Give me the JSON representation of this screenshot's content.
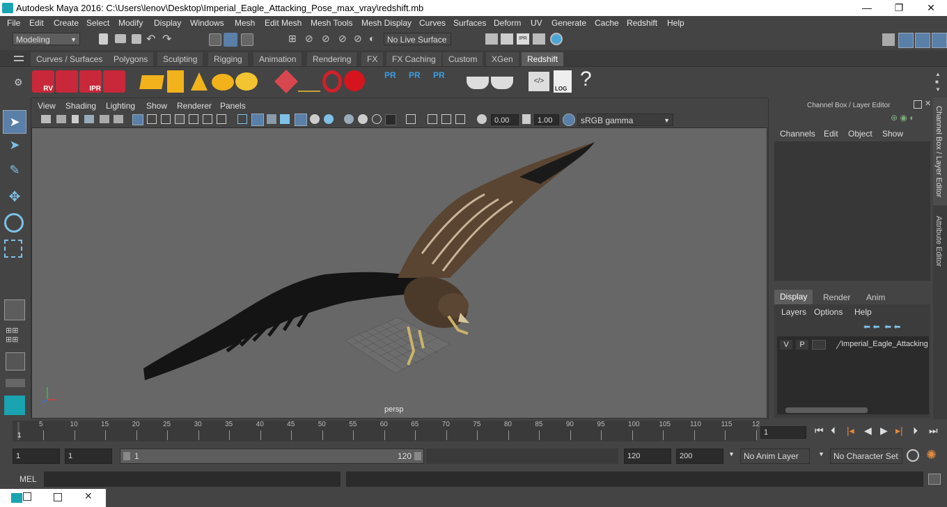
{
  "title": "Autodesk Maya 2016: C:\\Users\\lenov\\Desktop\\Imperial_Eagle_Attacking_Pose_max_vray\\redshift.mb",
  "window_controls": {
    "minimize": "—",
    "maximize": "❐",
    "close": "✕"
  },
  "menubar": [
    "File",
    "Edit",
    "Create",
    "Select",
    "Modify",
    "Display",
    "Windows",
    "Mesh",
    "Edit Mesh",
    "Mesh Tools",
    "Mesh Display",
    "Curves",
    "Surfaces",
    "Deform",
    "UV",
    "Generate",
    "Cache",
    "Redshift",
    "Help"
  ],
  "status": {
    "mode": "Modeling",
    "live_surface": "No Live Surface"
  },
  "shelf_tabs": [
    "Curves / Surfaces",
    "Polygons",
    "Sculpting",
    "Rigging",
    "Animation",
    "Rendering",
    "FX",
    "FX Caching",
    "Custom",
    "XGen",
    "Redshift"
  ],
  "shelf_active": "Redshift",
  "shelf_labels": {
    "rv": "RV",
    "ipr": "IPR",
    "pr1": "PR",
    "pr2": "PR",
    "pr3": "PR",
    "log": "LOG",
    "help": "?"
  },
  "viewport": {
    "menu": [
      "View",
      "Shading",
      "Lighting",
      "Show",
      "Renderer",
      "Panels"
    ],
    "exposure": "0.00",
    "gamma": "1.00",
    "color_space": "sRGB gamma",
    "camera": "persp"
  },
  "channel_box": {
    "title": "Channel Box / Layer Editor",
    "menu": [
      "Channels",
      "Edit",
      "Object",
      "Show"
    ],
    "layer_tabs": [
      "Display",
      "Render",
      "Anim"
    ],
    "layer_tab_active": "Display",
    "layer_menu": [
      "Layers",
      "Options",
      "Help"
    ],
    "layer": {
      "v": "V",
      "p": "P",
      "name": "Imperial_Eagle_Attacking"
    }
  },
  "side_tabs": {
    "channel": "Channel Box / Layer Editor",
    "attribute": "Attribute Editor"
  },
  "timeline": {
    "ticks": [
      "5",
      "10",
      "15",
      "20",
      "25",
      "30",
      "35",
      "40",
      "45",
      "50",
      "55",
      "60",
      "65",
      "70",
      "75",
      "80",
      "85",
      "90",
      "95",
      "100",
      "105",
      "110",
      "115",
      "12"
    ],
    "start_marker": "1",
    "current_frame": "1"
  },
  "range": {
    "start": "1",
    "anim_start": "1",
    "slider_start": "1",
    "slider_end": "120",
    "end": "120",
    "anim_end": "200",
    "anim_layer": "No Anim Layer",
    "char_set": "No Character Set"
  },
  "mel": {
    "label": "MEL"
  }
}
